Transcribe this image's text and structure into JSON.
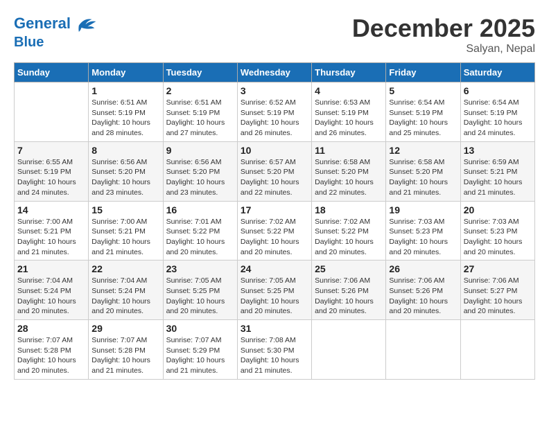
{
  "header": {
    "logo_line1": "General",
    "logo_line2": "Blue",
    "month": "December 2025",
    "location": "Salyan, Nepal"
  },
  "weekdays": [
    "Sunday",
    "Monday",
    "Tuesday",
    "Wednesday",
    "Thursday",
    "Friday",
    "Saturday"
  ],
  "weeks": [
    [
      {
        "day": "",
        "detail": ""
      },
      {
        "day": "1",
        "detail": "Sunrise: 6:51 AM\nSunset: 5:19 PM\nDaylight: 10 hours\nand 28 minutes."
      },
      {
        "day": "2",
        "detail": "Sunrise: 6:51 AM\nSunset: 5:19 PM\nDaylight: 10 hours\nand 27 minutes."
      },
      {
        "day": "3",
        "detail": "Sunrise: 6:52 AM\nSunset: 5:19 PM\nDaylight: 10 hours\nand 26 minutes."
      },
      {
        "day": "4",
        "detail": "Sunrise: 6:53 AM\nSunset: 5:19 PM\nDaylight: 10 hours\nand 26 minutes."
      },
      {
        "day": "5",
        "detail": "Sunrise: 6:54 AM\nSunset: 5:19 PM\nDaylight: 10 hours\nand 25 minutes."
      },
      {
        "day": "6",
        "detail": "Sunrise: 6:54 AM\nSunset: 5:19 PM\nDaylight: 10 hours\nand 24 minutes."
      }
    ],
    [
      {
        "day": "7",
        "detail": "Sunrise: 6:55 AM\nSunset: 5:19 PM\nDaylight: 10 hours\nand 24 minutes."
      },
      {
        "day": "8",
        "detail": "Sunrise: 6:56 AM\nSunset: 5:20 PM\nDaylight: 10 hours\nand 23 minutes."
      },
      {
        "day": "9",
        "detail": "Sunrise: 6:56 AM\nSunset: 5:20 PM\nDaylight: 10 hours\nand 23 minutes."
      },
      {
        "day": "10",
        "detail": "Sunrise: 6:57 AM\nSunset: 5:20 PM\nDaylight: 10 hours\nand 22 minutes."
      },
      {
        "day": "11",
        "detail": "Sunrise: 6:58 AM\nSunset: 5:20 PM\nDaylight: 10 hours\nand 22 minutes."
      },
      {
        "day": "12",
        "detail": "Sunrise: 6:58 AM\nSunset: 5:20 PM\nDaylight: 10 hours\nand 21 minutes."
      },
      {
        "day": "13",
        "detail": "Sunrise: 6:59 AM\nSunset: 5:21 PM\nDaylight: 10 hours\nand 21 minutes."
      }
    ],
    [
      {
        "day": "14",
        "detail": "Sunrise: 7:00 AM\nSunset: 5:21 PM\nDaylight: 10 hours\nand 21 minutes."
      },
      {
        "day": "15",
        "detail": "Sunrise: 7:00 AM\nSunset: 5:21 PM\nDaylight: 10 hours\nand 21 minutes."
      },
      {
        "day": "16",
        "detail": "Sunrise: 7:01 AM\nSunset: 5:22 PM\nDaylight: 10 hours\nand 20 minutes."
      },
      {
        "day": "17",
        "detail": "Sunrise: 7:02 AM\nSunset: 5:22 PM\nDaylight: 10 hours\nand 20 minutes."
      },
      {
        "day": "18",
        "detail": "Sunrise: 7:02 AM\nSunset: 5:22 PM\nDaylight: 10 hours\nand 20 minutes."
      },
      {
        "day": "19",
        "detail": "Sunrise: 7:03 AM\nSunset: 5:23 PM\nDaylight: 10 hours\nand 20 minutes."
      },
      {
        "day": "20",
        "detail": "Sunrise: 7:03 AM\nSunset: 5:23 PM\nDaylight: 10 hours\nand 20 minutes."
      }
    ],
    [
      {
        "day": "21",
        "detail": "Sunrise: 7:04 AM\nSunset: 5:24 PM\nDaylight: 10 hours\nand 20 minutes."
      },
      {
        "day": "22",
        "detail": "Sunrise: 7:04 AM\nSunset: 5:24 PM\nDaylight: 10 hours\nand 20 minutes."
      },
      {
        "day": "23",
        "detail": "Sunrise: 7:05 AM\nSunset: 5:25 PM\nDaylight: 10 hours\nand 20 minutes."
      },
      {
        "day": "24",
        "detail": "Sunrise: 7:05 AM\nSunset: 5:25 PM\nDaylight: 10 hours\nand 20 minutes."
      },
      {
        "day": "25",
        "detail": "Sunrise: 7:06 AM\nSunset: 5:26 PM\nDaylight: 10 hours\nand 20 minutes."
      },
      {
        "day": "26",
        "detail": "Sunrise: 7:06 AM\nSunset: 5:26 PM\nDaylight: 10 hours\nand 20 minutes."
      },
      {
        "day": "27",
        "detail": "Sunrise: 7:06 AM\nSunset: 5:27 PM\nDaylight: 10 hours\nand 20 minutes."
      }
    ],
    [
      {
        "day": "28",
        "detail": "Sunrise: 7:07 AM\nSunset: 5:28 PM\nDaylight: 10 hours\nand 20 minutes."
      },
      {
        "day": "29",
        "detail": "Sunrise: 7:07 AM\nSunset: 5:28 PM\nDaylight: 10 hours\nand 21 minutes."
      },
      {
        "day": "30",
        "detail": "Sunrise: 7:07 AM\nSunset: 5:29 PM\nDaylight: 10 hours\nand 21 minutes."
      },
      {
        "day": "31",
        "detail": "Sunrise: 7:08 AM\nSunset: 5:30 PM\nDaylight: 10 hours\nand 21 minutes."
      },
      {
        "day": "",
        "detail": ""
      },
      {
        "day": "",
        "detail": ""
      },
      {
        "day": "",
        "detail": ""
      }
    ]
  ]
}
